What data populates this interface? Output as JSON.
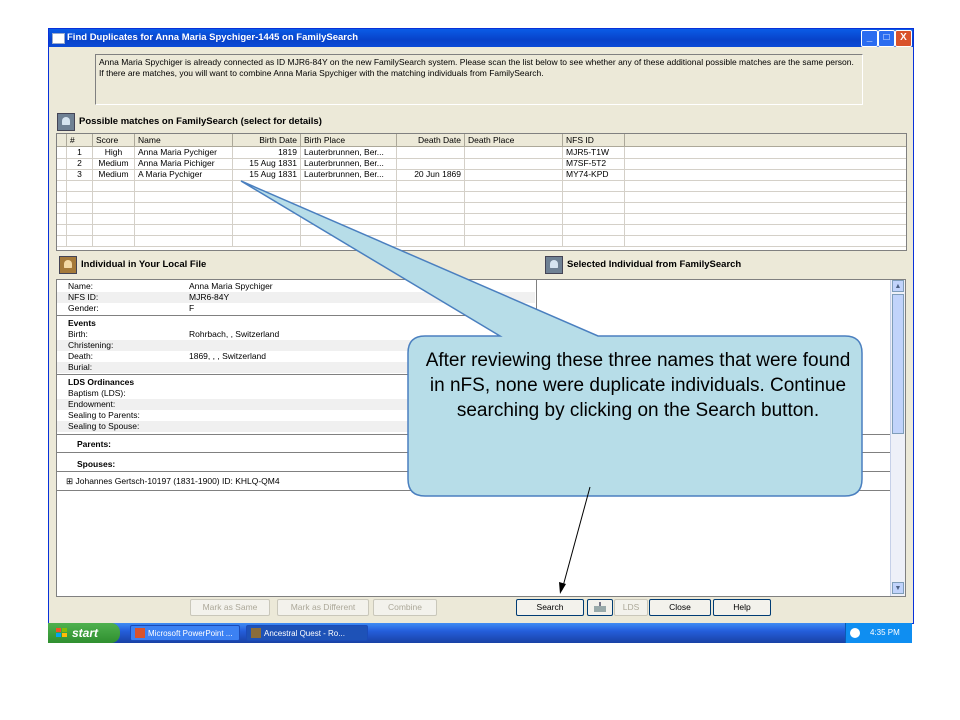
{
  "window": {
    "title": "Find Duplicates for Anna Maria Spychiger-1445 on FamilySearch",
    "buttons": {
      "minimize": "_",
      "maximize": "□",
      "close": "X"
    }
  },
  "message": "Anna Maria Spychiger is already connected as ID MJR6-84Y on the new FamilySearch system. Please scan the list below to see whether any of these additional possible matches are the same person. If there are matches, you will want to combine Anna Maria Spychiger with the matching individuals from FamilySearch.",
  "matches": {
    "header": "Possible matches on FamilySearch (select for details)",
    "columns": [
      "#",
      "Score",
      "Name",
      "Birth Date",
      "Birth Place",
      "Death Date",
      "Death Place",
      "NFS ID"
    ],
    "rows": [
      {
        "num": "1",
        "score": "High",
        "name": "Anna Maria Pychiger",
        "birth_date": "1819",
        "birth_place": "Lauterbrunnen, Ber...",
        "death_date": "",
        "death_place": "",
        "nfs_id": "MJR5-T1W"
      },
      {
        "num": "2",
        "score": "Medium",
        "name": "Anna Maria Pichiger",
        "birth_date": "15 Aug 1831",
        "birth_place": "Lauterbrunnen, Ber...",
        "death_date": "",
        "death_place": "",
        "nfs_id": "M7SF-5T2"
      },
      {
        "num": "3",
        "score": "Medium",
        "name": "A Maria Pychiger",
        "birth_date": "15 Aug 1831",
        "birth_place": "Lauterbrunnen, Ber...",
        "death_date": "20 Jun 1869",
        "death_place": "",
        "nfs_id": "MY74-KPD"
      }
    ]
  },
  "local": {
    "header": "Individual in Your Local File",
    "name_label": "Name:",
    "name": "Anna Maria Spychiger",
    "nfs_label": "NFS ID:",
    "nfs_id": "MJR6-84Y",
    "gender_label": "Gender:",
    "gender": "F",
    "events_title": "Events",
    "birth_label": "Birth:",
    "birth": "Rohrbach, , Switzerland",
    "christening_label": "Christening:",
    "death_label": "Death:",
    "death": "1869, , , Switzerland",
    "burial_label": "Burial:",
    "ordinances_title": "LDS Ordinances",
    "baptism_label": "Baptism (LDS):",
    "endowment_label": "Endowment:",
    "sealing_parents_label": "Sealing to Parents:",
    "sealing_spouse_label": "Sealing to Spouse:",
    "parents_label": "Parents:",
    "spouses_label": "Spouses:",
    "expand": "⊞",
    "spouse_entry": "Johannes Gertsch-10197 (1831-1900)  ID: KHLQ-QM4"
  },
  "familysearch": {
    "header": "Selected Individual from FamilySearch"
  },
  "buttons": {
    "mark_same": "Mark as Same",
    "mark_different": "Mark as Different",
    "combine": "Combine",
    "search": "Search",
    "lds": "LDS",
    "close": "Close",
    "help": "Help"
  },
  "taskbar": {
    "start": "start",
    "items": [
      "Microsoft PowerPoint ...",
      "Ancestral Quest - Ro..."
    ],
    "clock": "4:35 PM"
  },
  "callout": "After reviewing these three names that were found in nFS, none were duplicate individuals.  Continue searching by clicking on the Search button.",
  "colors": {
    "titlebar": "#0a5ce6",
    "callout_fill": "#b7dde8",
    "callout_border": "#4a7fbf",
    "window_bg": "#ece9d8"
  }
}
